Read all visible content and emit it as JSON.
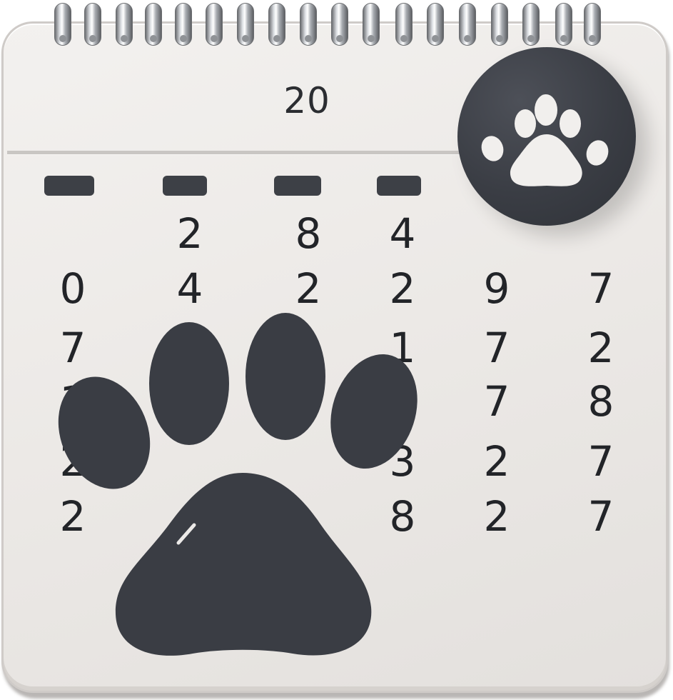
{
  "calendar": {
    "header_title": "20",
    "weekday_bars": [
      "bar-1",
      "bar-2",
      "bar-3",
      "bar-4"
    ],
    "rows": [
      [
        "",
        "2",
        "8",
        "4",
        "",
        ""
      ],
      [
        "0",
        "4",
        "2",
        "2",
        "9",
        "7"
      ],
      [
        "7",
        "",
        "",
        "1",
        "7",
        "2"
      ],
      [
        "1",
        "",
        "",
        "",
        "7",
        "8"
      ],
      [
        "2",
        "",
        "",
        "3",
        "2",
        "7"
      ],
      [
        "2",
        "",
        "",
        "8",
        "2",
        "7"
      ]
    ]
  },
  "badge": {
    "icon": "paw-icon"
  },
  "paw": {
    "icon": "paw-print-icon",
    "color": "#3a3d44"
  },
  "colors": {
    "paper": "#ebe8e5",
    "ink": "#222428",
    "paw": "#3a3d44"
  }
}
